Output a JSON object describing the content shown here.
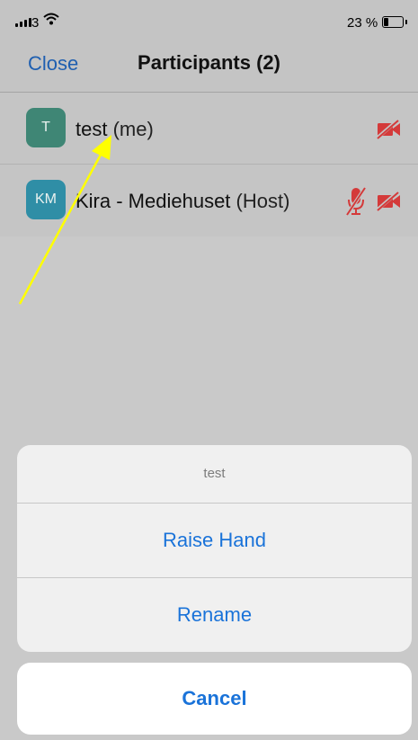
{
  "status_bar": {
    "carrier": "3",
    "battery_percent": "23 %",
    "battery_level": 0.23,
    "signal_icon": "signal-bars-icon",
    "wifi_icon": "wifi-icon",
    "battery_icon": "battery-icon"
  },
  "nav": {
    "close_label": "Close",
    "title": "Participants (2)"
  },
  "participants": [
    {
      "initials": "T",
      "name": "test",
      "role": "(me)",
      "avatar_color": "#3f8675",
      "icons": [
        "video-off-icon"
      ]
    },
    {
      "initials": "KM",
      "name": "Kira - Mediehuset",
      "role": "(Host)",
      "avatar_color": "#2f8ea6",
      "icons": [
        "mic-off-icon",
        "video-off-icon"
      ]
    }
  ],
  "action_sheet": {
    "title": "test",
    "actions": [
      {
        "label": "Raise Hand"
      },
      {
        "label": "Rename"
      }
    ],
    "cancel_label": "Cancel"
  },
  "colors": {
    "accent_blue": "#1a73d9",
    "nav_blue": "#1f5fb0",
    "muted_red": "#d43a3a",
    "annotation_arrow": "#ffff00"
  }
}
